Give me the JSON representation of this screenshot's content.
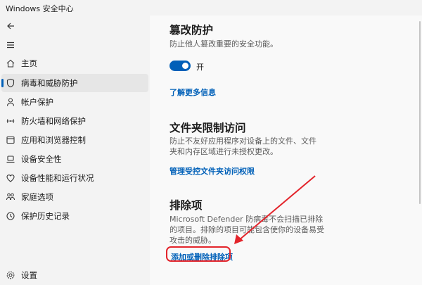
{
  "window": {
    "title": "Windows 安全中心"
  },
  "sidebar": {
    "items": [
      {
        "label": "主页",
        "icon": "home-icon"
      },
      {
        "label": "病毒和威胁防护",
        "icon": "shield-icon",
        "active": true
      },
      {
        "label": "帐户保护",
        "icon": "person-icon"
      },
      {
        "label": "防火墙和网络保护",
        "icon": "wifi-icon"
      },
      {
        "label": "应用和浏览器控制",
        "icon": "app-window-icon"
      },
      {
        "label": "设备安全性",
        "icon": "laptop-icon"
      },
      {
        "label": "设备性能和运行状况",
        "icon": "heart-icon"
      },
      {
        "label": "家庭选项",
        "icon": "family-icon"
      },
      {
        "label": "保护历史记录",
        "icon": "history-icon"
      }
    ],
    "settings": {
      "label": "设置",
      "icon": "gear-icon"
    }
  },
  "tamper": {
    "title": "篡改防护",
    "desc": "防止他人篡改重要的安全功能。",
    "toggle_label": "开",
    "toggle_on": true,
    "link": "了解更多信息"
  },
  "folder": {
    "title": "文件夹限制访问",
    "desc": "防止不友好应用程序对设备上的文件、文件夹和内存区域进行未授权更改。",
    "link": "管理受控文件夹访问权限"
  },
  "exclusions": {
    "title": "排除项",
    "desc": "Microsoft Defender 防病毒不会扫描已排除的项目。排除的项目可能包含使你的设备易受攻击的威胁。",
    "link": "添加或删除排除项"
  },
  "colors": {
    "accent": "#005fb8",
    "annotation": "#e3242b"
  }
}
